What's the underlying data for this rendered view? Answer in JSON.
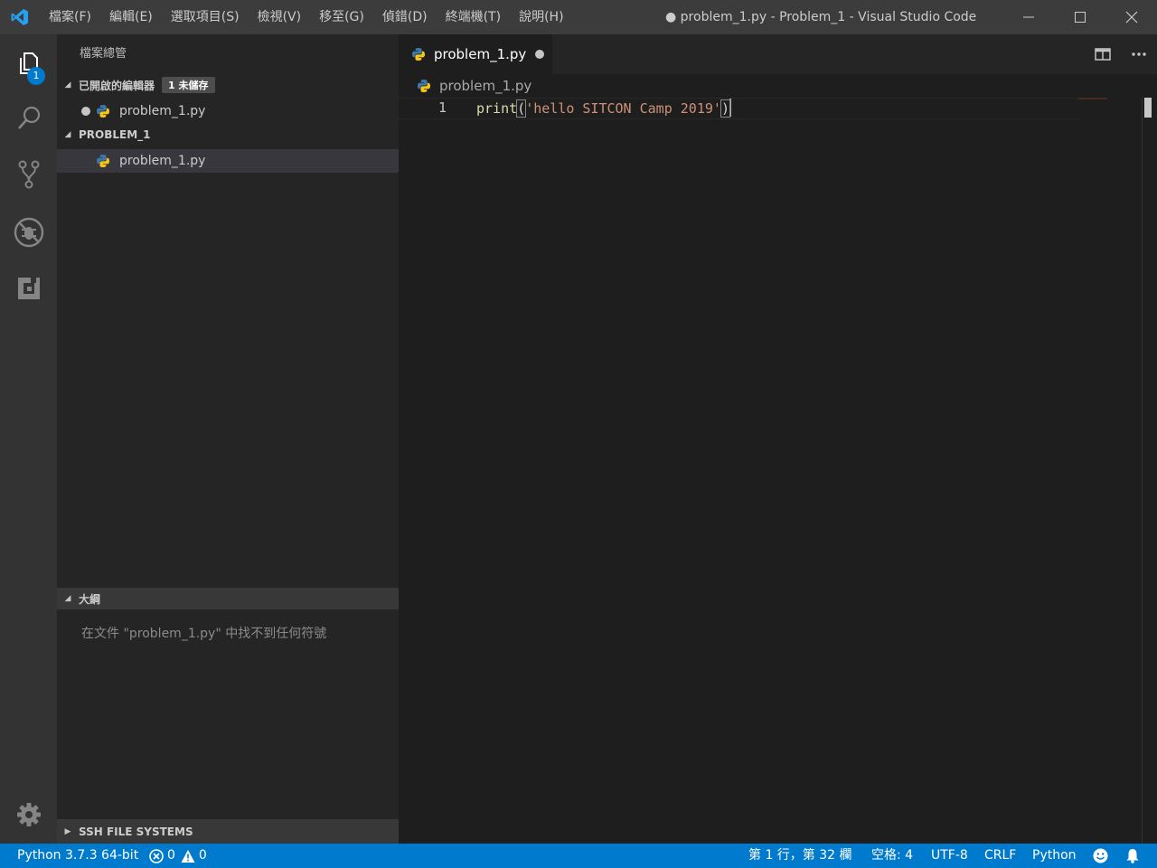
{
  "titlebar": {
    "menu": [
      "檔案(F)",
      "編輯(E)",
      "選取項目(S)",
      "檢視(V)",
      "移至(G)",
      "偵錯(D)",
      "終端機(T)",
      "說明(H)"
    ],
    "window_title": "● problem_1.py - Problem_1 - Visual Studio Code"
  },
  "activitybar": {
    "explorer_badge": "1"
  },
  "sidebar": {
    "title": "檔案總管",
    "open_editors": {
      "label": "已開啟的編輯器",
      "dirty_badge": "1 未儲存",
      "files": [
        "problem_1.py"
      ]
    },
    "folder": {
      "label": "PROBLEM_1",
      "files": [
        "problem_1.py"
      ]
    },
    "outline": {
      "label": "大綱",
      "message": "在文件 \"problem_1.py\" 中找不到任何符號"
    },
    "ssh": {
      "label": "SSH FILE SYSTEMS"
    }
  },
  "editor": {
    "tab_label": "problem_1.py",
    "breadcrumb": "problem_1.py",
    "line_number": "1",
    "code": {
      "fn": "print",
      "open_paren": "(",
      "string": "'hello SITCON Camp 2019'",
      "close_paren": ")"
    }
  },
  "statusbar": {
    "interpreter": "Python 3.7.3 64-bit",
    "errors": "0",
    "warnings": "0",
    "position": "第 1 行，第 32 欄",
    "indent": "空格: 4",
    "encoding": "UTF-8",
    "eol": "CRLF",
    "language": "Python"
  },
  "colors": {
    "accent": "#007acc",
    "titlebar": "#3c3c3c",
    "activitybar": "#333333",
    "sidebar": "#252526",
    "editor": "#1e1e1e"
  },
  "icons": [
    "vscode-logo-icon",
    "explorer-icon",
    "search-icon",
    "source-control-icon",
    "debug-icon",
    "extensions-icon",
    "gear-icon",
    "python-file-icon",
    "split-editor-icon",
    "more-actions-icon",
    "error-icon",
    "warning-icon",
    "feedback-smiley-icon",
    "notifications-bell-icon"
  ]
}
